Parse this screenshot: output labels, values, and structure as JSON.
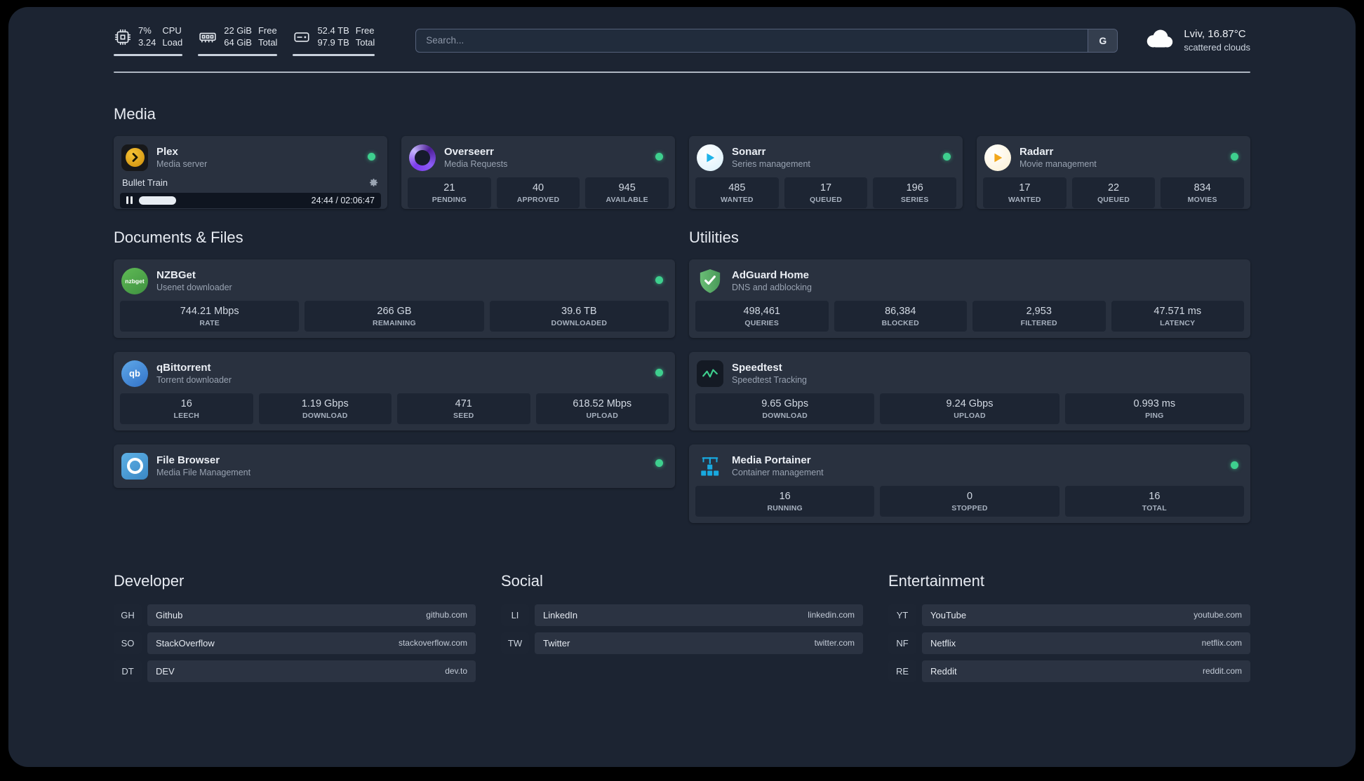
{
  "topbar": {
    "cpu": {
      "value1": "7%",
      "value2": "3.24",
      "label1": "CPU",
      "label2": "Load"
    },
    "memory": {
      "value1": "22 GiB",
      "value2": "64 GiB",
      "label1": "Free",
      "label2": "Total"
    },
    "disk": {
      "value1": "52.4 TB",
      "value2": "97.9 TB",
      "label1": "Free",
      "label2": "Total"
    },
    "search": {
      "placeholder": "Search...",
      "button": "G"
    },
    "weather": {
      "location": "Lviv, 16.87°C",
      "condition": "scattered clouds"
    }
  },
  "sections": {
    "media": {
      "title": "Media",
      "cards": [
        {
          "title": "Plex",
          "subtitle": "Media server",
          "status": "online",
          "player": {
            "track": "Bullet Train",
            "time": "24:44 / 02:06:47",
            "progress_fraction": 0.15
          }
        },
        {
          "title": "Overseerr",
          "subtitle": "Media Requests",
          "status": "online",
          "stats": [
            {
              "value": "21",
              "label": "PENDING"
            },
            {
              "value": "40",
              "label": "APPROVED"
            },
            {
              "value": "945",
              "label": "AVAILABLE"
            }
          ]
        },
        {
          "title": "Sonarr",
          "subtitle": "Series management",
          "status": "online",
          "stats": [
            {
              "value": "485",
              "label": "WANTED"
            },
            {
              "value": "17",
              "label": "QUEUED"
            },
            {
              "value": "196",
              "label": "SERIES"
            }
          ]
        },
        {
          "title": "Radarr",
          "subtitle": "Movie management",
          "status": "online",
          "stats": [
            {
              "value": "17",
              "label": "WANTED"
            },
            {
              "value": "22",
              "label": "QUEUED"
            },
            {
              "value": "834",
              "label": "MOVIES"
            }
          ]
        }
      ]
    },
    "documents": {
      "title": "Documents & Files",
      "cards": [
        {
          "title": "NZBGet",
          "subtitle": "Usenet downloader",
          "status": "online",
          "icon_text": "nzbget",
          "stats": [
            {
              "value": "744.21 Mbps",
              "label": "RATE"
            },
            {
              "value": "266 GB",
              "label": "REMAINING"
            },
            {
              "value": "39.6 TB",
              "label": "DOWNLOADED"
            }
          ]
        },
        {
          "title": "qBittorrent",
          "subtitle": "Torrent downloader",
          "status": "online",
          "icon_text": "qb",
          "stats": [
            {
              "value": "16",
              "label": "LEECH"
            },
            {
              "value": "1.19 Gbps",
              "label": "DOWNLOAD"
            },
            {
              "value": "471",
              "label": "SEED"
            },
            {
              "value": "618.52 Mbps",
              "label": "UPLOAD"
            }
          ]
        },
        {
          "title": "File Browser",
          "subtitle": "Media File Management",
          "status": "online"
        }
      ]
    },
    "utilities": {
      "title": "Utilities",
      "cards": [
        {
          "title": "AdGuard Home",
          "subtitle": "DNS and adblocking",
          "stats": [
            {
              "value": "498,461",
              "label": "QUERIES"
            },
            {
              "value": "86,384",
              "label": "BLOCKED"
            },
            {
              "value": "2,953",
              "label": "FILTERED"
            },
            {
              "value": "47.571 ms",
              "label": "LATENCY"
            }
          ]
        },
        {
          "title": "Speedtest",
          "subtitle": "Speedtest Tracking",
          "stats": [
            {
              "value": "9.65 Gbps",
              "label": "DOWNLOAD"
            },
            {
              "value": "9.24 Gbps",
              "label": "UPLOAD"
            },
            {
              "value": "0.993 ms",
              "label": "PING"
            }
          ]
        },
        {
          "title": "Media Portainer",
          "subtitle": "Container management",
          "status": "online",
          "stats": [
            {
              "value": "16",
              "label": "RUNNING"
            },
            {
              "value": "0",
              "label": "STOPPED"
            },
            {
              "value": "16",
              "label": "TOTAL"
            }
          ]
        }
      ]
    }
  },
  "bookmarks": [
    {
      "title": "Developer",
      "items": [
        {
          "abbr": "GH",
          "name": "Github",
          "domain": "github.com"
        },
        {
          "abbr": "SO",
          "name": "StackOverflow",
          "domain": "stackoverflow.com"
        },
        {
          "abbr": "DT",
          "name": "DEV",
          "domain": "dev.to"
        }
      ]
    },
    {
      "title": "Social",
      "items": [
        {
          "abbr": "LI",
          "name": "LinkedIn",
          "domain": "linkedin.com"
        },
        {
          "abbr": "TW",
          "name": "Twitter",
          "domain": "twitter.com"
        }
      ]
    },
    {
      "title": "Entertainment",
      "items": [
        {
          "abbr": "YT",
          "name": "YouTube",
          "domain": "youtube.com"
        },
        {
          "abbr": "NF",
          "name": "Netflix",
          "domain": "netflix.com"
        },
        {
          "abbr": "RE",
          "name": "Reddit",
          "domain": "reddit.com"
        }
      ]
    }
  ],
  "colors": {
    "status_online": "#3ecf8e",
    "page_bg": "#1c2432",
    "card_bg": "#29313f",
    "tile_bg": "#1d2533"
  }
}
